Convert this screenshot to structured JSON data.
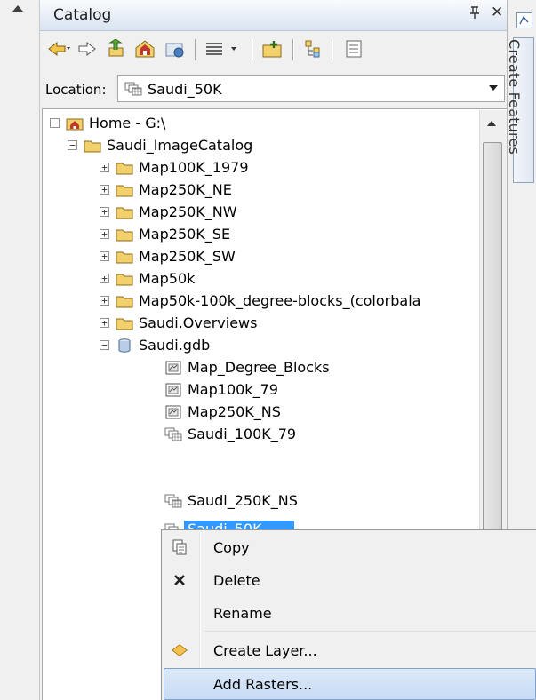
{
  "panel": {
    "title": "Catalog",
    "pin_glyph": "บ",
    "close_glyph": "✕"
  },
  "toolbar": {
    "buttons": [
      "back-arrow-icon",
      "forward-arrow-icon",
      "up-one-level-icon",
      "home-folder-icon",
      "connect-folder-icon",
      "view-options-icon",
      "new-item-icon",
      "toggle-contents-icon",
      "options-icon"
    ]
  },
  "location": {
    "label": "Location:",
    "value": "Saudi_50K"
  },
  "right_dock": {
    "tab_label": "Create Features"
  },
  "tree": {
    "root": {
      "label": "Home - G:\\",
      "expander": "−"
    },
    "catalog": {
      "label": "Saudi_ImageCatalog",
      "expander": "−"
    },
    "folders": [
      {
        "label": "Map100K_1979",
        "expander": "+"
      },
      {
        "label": "Map250K_NE",
        "expander": "+"
      },
      {
        "label": "Map250K_NW",
        "expander": "+"
      },
      {
        "label": "Map250K_SE",
        "expander": "+"
      },
      {
        "label": "Map250K_SW",
        "expander": "+"
      },
      {
        "label": "Map50k",
        "expander": "+"
      },
      {
        "label": "Map50k-100k_degree-blocks_(colorbala",
        "expander": "+"
      },
      {
        "label": "Saudi.Overviews",
        "expander": "+"
      }
    ],
    "gdb": {
      "label": "Saudi.gdb",
      "expander": "−"
    },
    "gdb_items": [
      {
        "label": "Map_Degree_Blocks",
        "type": "raster-dataset"
      },
      {
        "label": "Map100k_79",
        "type": "raster-dataset"
      },
      {
        "label": "Map250K_NS",
        "type": "raster-dataset"
      },
      {
        "label": "Saudi_100K_79",
        "type": "mosaic-dataset"
      },
      {
        "label": "Saudi_250K_NS",
        "type": "mosaic-dataset"
      }
    ],
    "selected": {
      "label": "Saudi_50K",
      "type": "mosaic-dataset"
    }
  },
  "context_menu": {
    "items": [
      {
        "label": "Copy",
        "icon": "copy-icon"
      },
      {
        "label": "Delete",
        "icon": "delete-x-icon"
      },
      {
        "label": "Rename",
        "icon": ""
      },
      {
        "label": "Create Layer...",
        "icon": "layer-diamond-icon"
      },
      {
        "label": "Add Rasters...",
        "icon": ""
      }
    ]
  },
  "colors": {
    "selection": "#3399ff",
    "folder": "#f2d06b",
    "highlight": "#c8dcf4"
  }
}
